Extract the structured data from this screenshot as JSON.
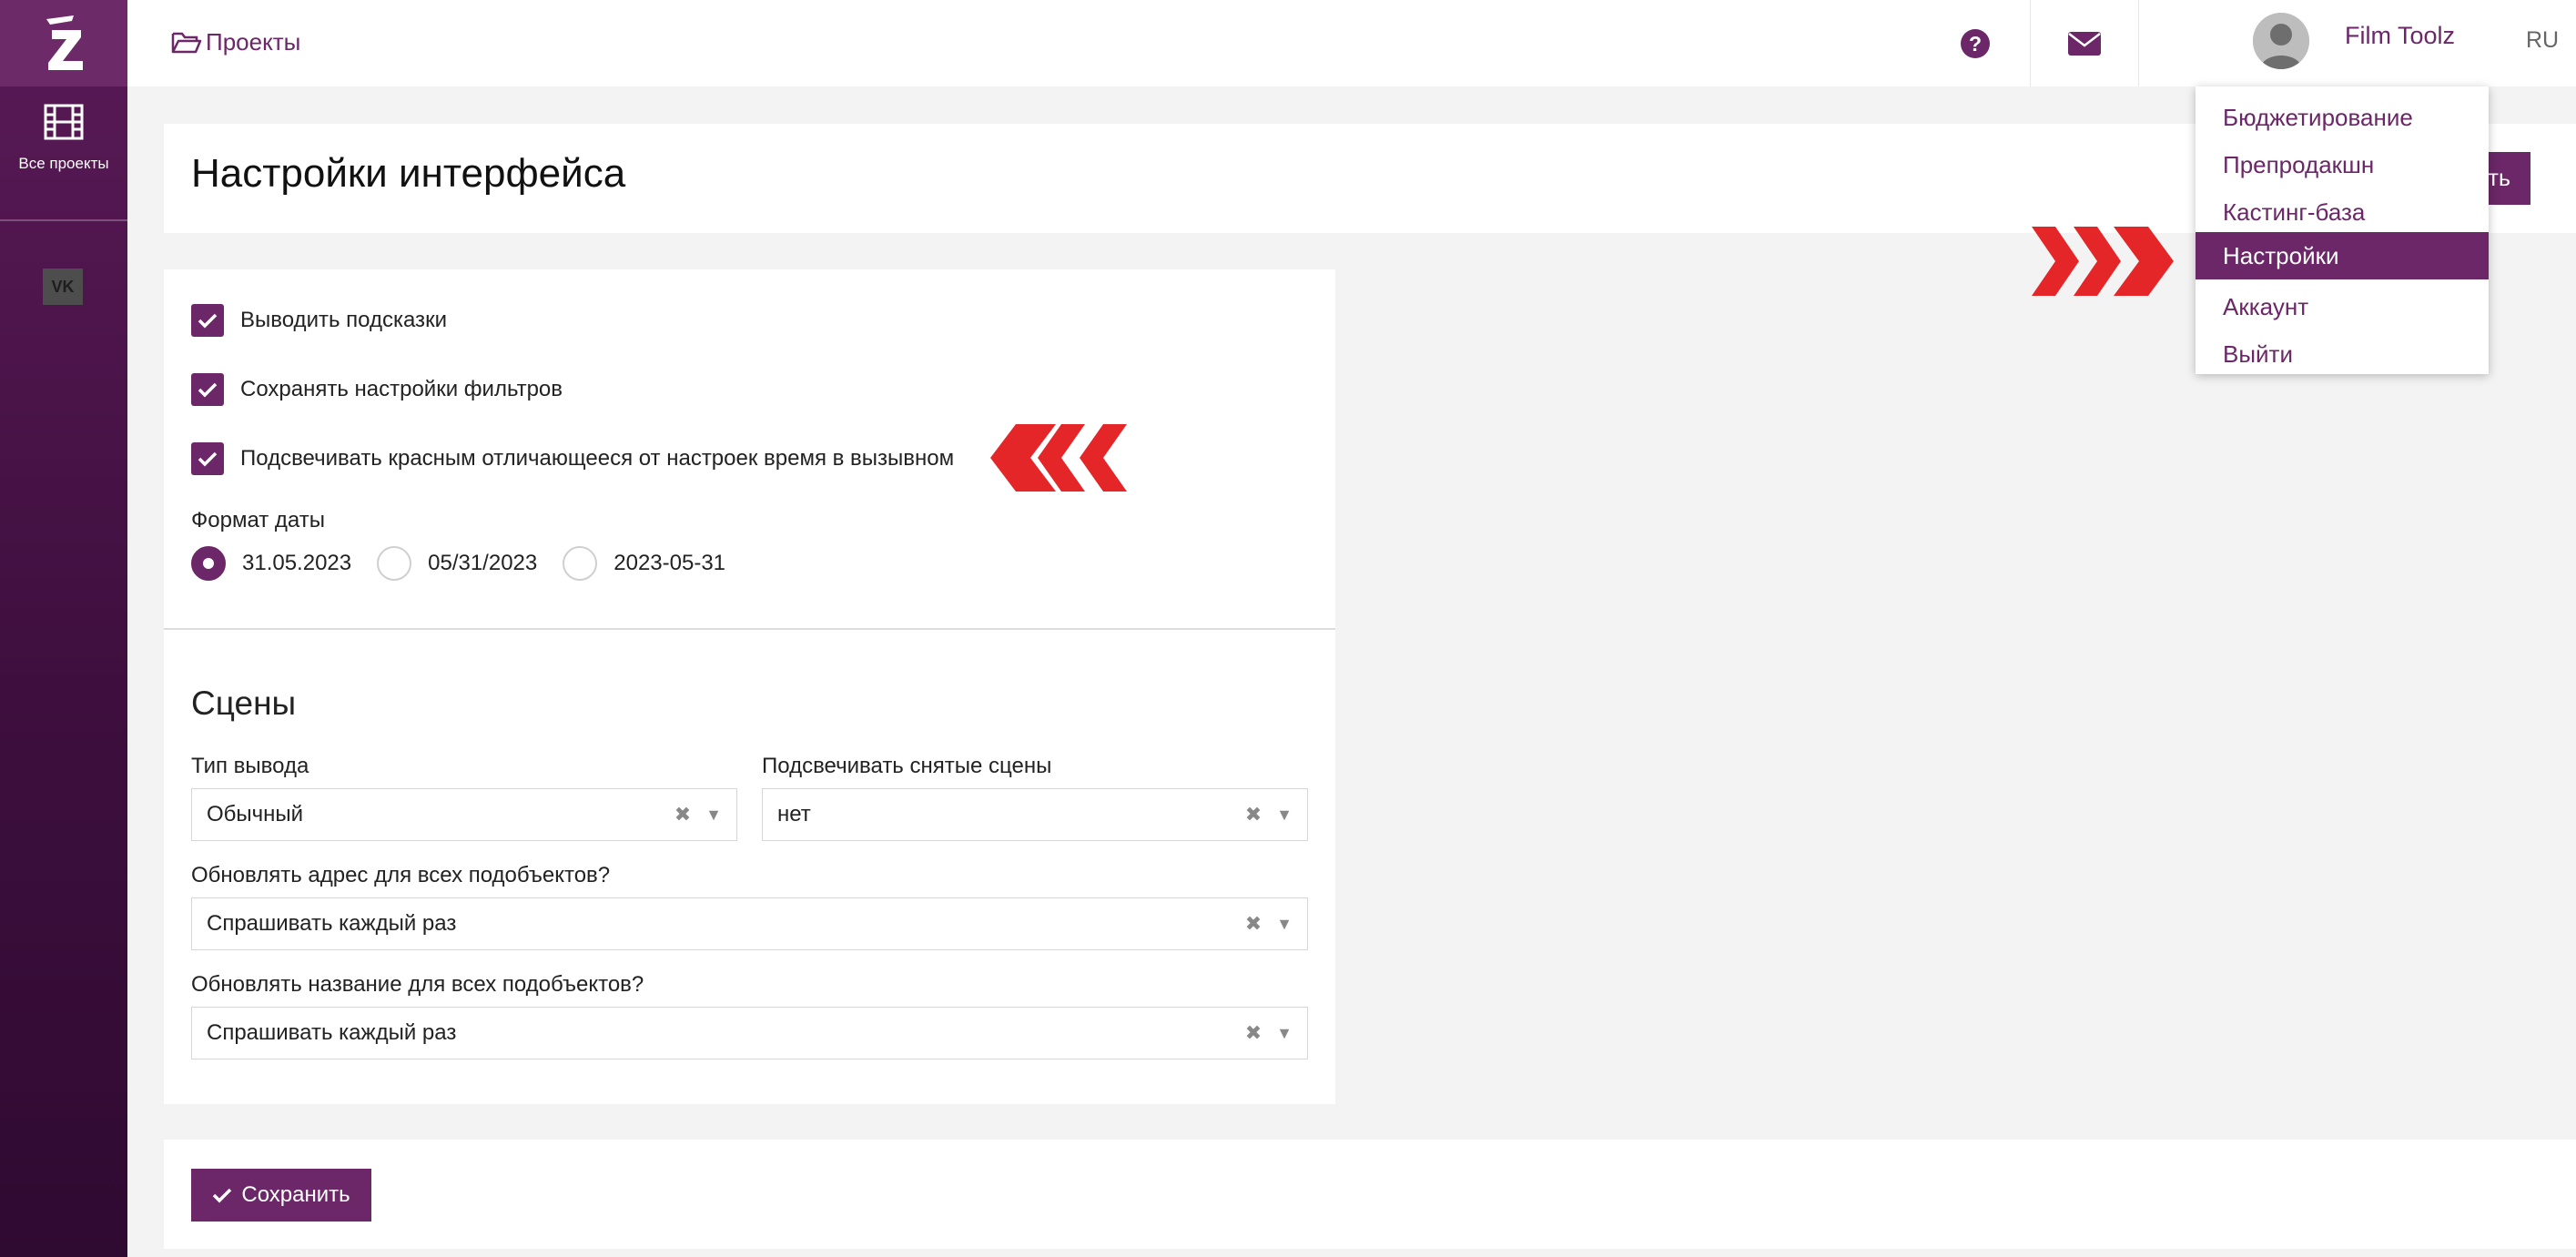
{
  "sidebar": {
    "logo_alt": "Z",
    "nav": [
      {
        "label": "Все проекты",
        "icon": "film-icon"
      }
    ],
    "social": [
      {
        "icon": "vk-icon",
        "label": "VK"
      }
    ]
  },
  "topbar": {
    "breadcrumb_label": "Проекты",
    "help_icon": "question-circle-icon",
    "mail_icon": "envelope-icon",
    "user_name": "Film Toolz",
    "lang": "RU"
  },
  "page": {
    "title": "Настройки интерфейса",
    "title_button_label": "ть"
  },
  "general": {
    "checkboxes": [
      {
        "label": "Выводить подсказки",
        "checked": true
      },
      {
        "label": "Сохранять настройки фильтров",
        "checked": true
      },
      {
        "label": "Подсвечивать красным отличающееся от настроек время в вызывном",
        "checked": true
      }
    ],
    "date_format_label": "Формат даты",
    "date_formats": [
      {
        "label": "31.05.2023",
        "selected": true
      },
      {
        "label": "05/31/2023",
        "selected": false
      },
      {
        "label": "2023-05-31",
        "selected": false
      }
    ]
  },
  "scenes": {
    "title": "Сцены",
    "output_type_label": "Тип вывода",
    "output_type_value": "Обычный",
    "highlight_label": "Подсвечивать снятые сцены",
    "highlight_value": "нет",
    "update_address_label": "Обновлять адрес для всех подобъектов?",
    "update_address_value": "Спрашивать каждый раз",
    "update_name_label": "Обновлять название для всех подобъектов?",
    "update_name_value": "Спрашивать каждый раз",
    "clear_glyph": "✖",
    "arrow_glyph": "▼"
  },
  "footer": {
    "save_label": "Сохранить"
  },
  "user_menu": {
    "items": [
      {
        "label": "Бюджетирование",
        "active": false
      },
      {
        "label": "Препродакшн",
        "active": false
      },
      {
        "label": "Кастинг-база",
        "active": false
      },
      {
        "label": "Настройки",
        "active": true
      },
      {
        "label": "Аккаунт",
        "active": false
      },
      {
        "label": "Выйти",
        "active": false
      }
    ]
  },
  "colors": {
    "brand": "#6b2767",
    "sidebar": "#4a1547",
    "annotation_arrow": "#e52629"
  }
}
